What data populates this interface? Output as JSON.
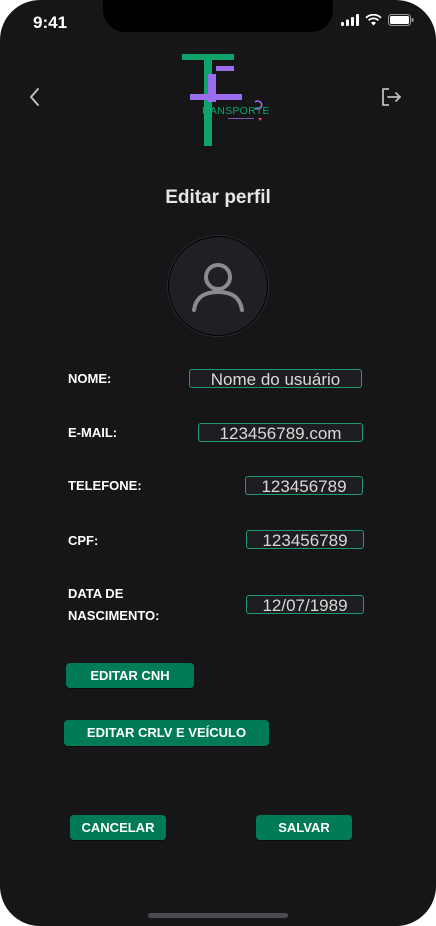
{
  "status_bar": {
    "time": "9:41"
  },
  "header": {
    "back_icon": "chevron-left-icon",
    "logout_icon": "logout-icon",
    "logo": {
      "wordmark": "RANSPORTE",
      "colors": {
        "green": "#0ea36a",
        "purple": "#9b6cf0"
      }
    }
  },
  "page": {
    "title": "Editar perfil"
  },
  "profile": {
    "avatar_icon": "user-icon"
  },
  "form": {
    "name": {
      "label": "NOME:",
      "value": "Nome do usuário"
    },
    "email": {
      "label": "E-MAIL:",
      "value": "123456789.com"
    },
    "phone": {
      "label": "TELEFONE:",
      "value": "123456789"
    },
    "cpf": {
      "label": "CPF:",
      "value": "123456789"
    },
    "birth": {
      "label_line1": "DATA DE",
      "label_line2": "NASCIMENTO:",
      "value": "12/07/1989"
    }
  },
  "actions": {
    "edit_cnh": "EDITAR CNH",
    "edit_crlv": "EDITAR CRLV E VEÍCULO",
    "cancel": "CANCELAR",
    "save": "SALVAR"
  },
  "colors": {
    "background": "#161618",
    "accent": "#007b55",
    "input_border": "#1f9a6e"
  }
}
